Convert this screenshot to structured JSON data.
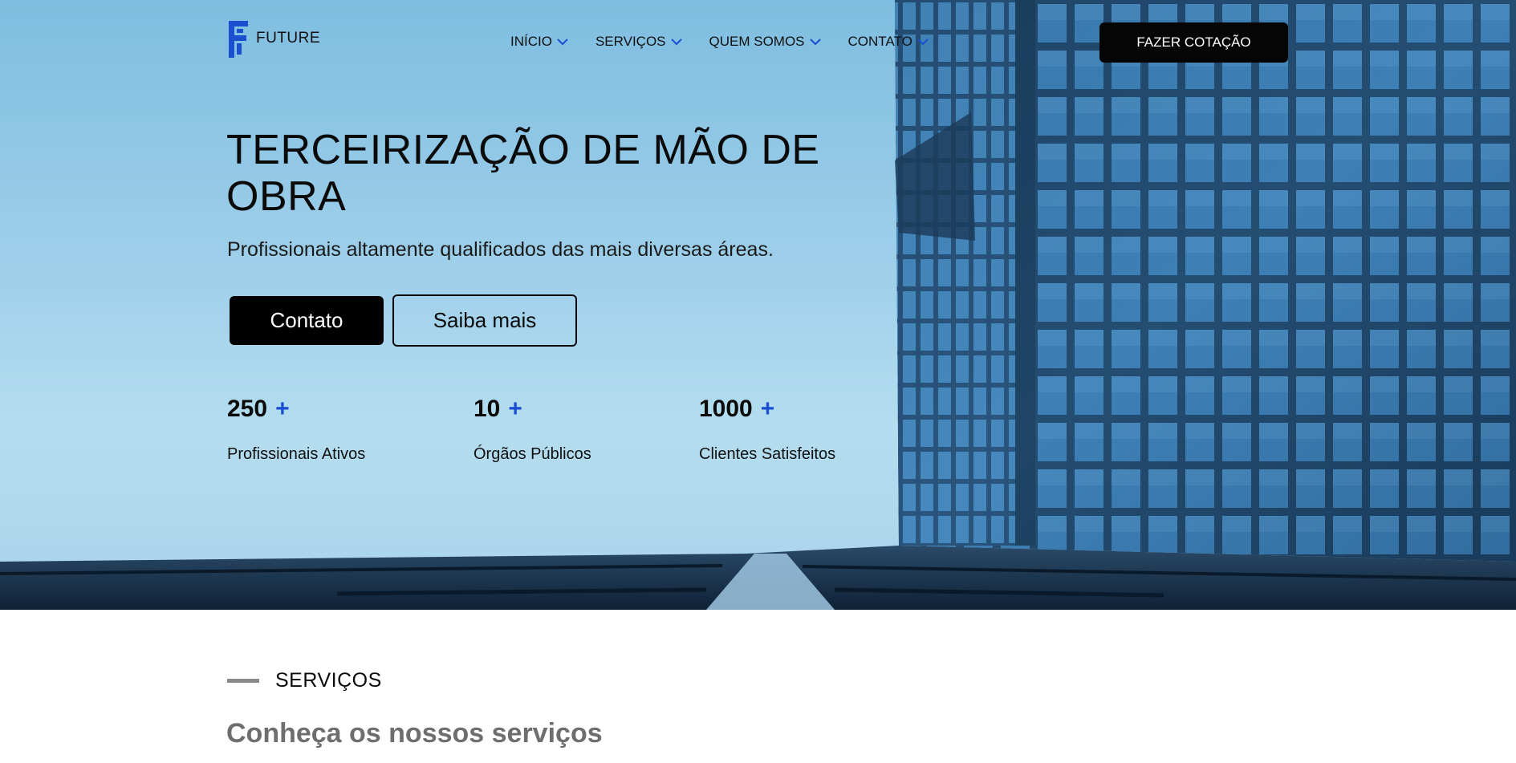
{
  "brand": {
    "name": "FUTURE",
    "accent": "#1a4fd0"
  },
  "nav": {
    "items": [
      {
        "label": "INÍCIO"
      },
      {
        "label": "SERVIÇOS"
      },
      {
        "label": "QUEM SOMOS"
      },
      {
        "label": "CONTATO"
      }
    ],
    "cta_label": "FAZER COTAÇÃO"
  },
  "hero": {
    "title": "TERCEIRIZAÇÃO DE MÃO DE OBRA",
    "subtitle": "Profissionais altamente qualificados das mais diversas áreas.",
    "primary_button": "Contato",
    "secondary_button": "Saiba mais",
    "stats": [
      {
        "value": "250",
        "plus": "+",
        "label": "Profissionais Ativos"
      },
      {
        "value": "10",
        "plus": "+",
        "label": "Órgãos Públicos"
      },
      {
        "value": "1000",
        "plus": "+",
        "label": "Clientes Satisfeitos"
      }
    ]
  },
  "services": {
    "label": "SERVIÇOS",
    "subtitle": "Conheça os nossos serviços"
  }
}
